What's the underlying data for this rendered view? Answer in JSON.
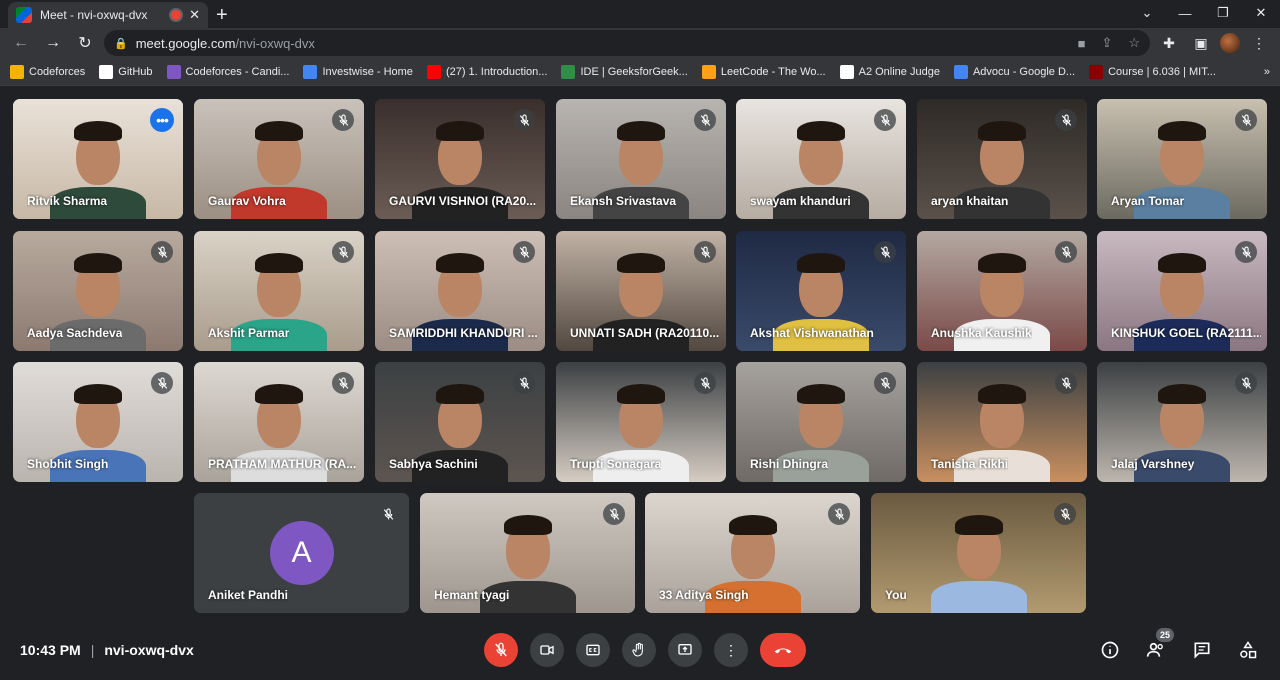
{
  "browser": {
    "tab_title": "Meet - nvi-oxwq-dvx",
    "url_host": "meet.google.com",
    "url_path": "/nvi-oxwq-dvx"
  },
  "bookmarks": [
    {
      "label": "Codeforces",
      "color": "#f4b400"
    },
    {
      "label": "GitHub",
      "color": "#ffffff"
    },
    {
      "label": "Codeforces - Candi...",
      "color": "#7e57c2"
    },
    {
      "label": "Investwise - Home",
      "color": "#4285f4"
    },
    {
      "label": "(27) 1. Introduction...",
      "color": "#ff0000"
    },
    {
      "label": "IDE | GeeksforGeek...",
      "color": "#2f8d46"
    },
    {
      "label": "LeetCode - The Wo...",
      "color": "#ffa116"
    },
    {
      "label": "A2 Online Judge",
      "color": "#ffffff"
    },
    {
      "label": "Advocu - Google D...",
      "color": "#4285f4"
    },
    {
      "label": "Course | 6.036 | MIT...",
      "color": "#8b0000"
    }
  ],
  "participants": [
    {
      "name": "Ritvik Sharma"
    },
    {
      "name": "Gaurav Vohra"
    },
    {
      "name": "GAURVI VISHNOI (RA20..."
    },
    {
      "name": "Ekansh Srivastava"
    },
    {
      "name": "swayam khanduri"
    },
    {
      "name": "aryan khaitan"
    },
    {
      "name": "Aryan Tomar"
    },
    {
      "name": "Aadya Sachdeva"
    },
    {
      "name": "Akshit Parmar"
    },
    {
      "name": "SAMRIDDHI KHANDURI ..."
    },
    {
      "name": "UNNATI SADH (RA20110..."
    },
    {
      "name": "Akshat Vishwanathan"
    },
    {
      "name": "Anushka Kaushik"
    },
    {
      "name": "KINSHUK GOEL (RA2111..."
    },
    {
      "name": "Shobhit Singh"
    },
    {
      "name": "PRATHAM MATHUR (RA..."
    },
    {
      "name": "Sabhya Sachini"
    },
    {
      "name": "Trupti Sonagara"
    },
    {
      "name": "Rishi Dhingra"
    },
    {
      "name": "Tanisha Rikhi"
    },
    {
      "name": "Jalaj Varshney"
    },
    {
      "name": "Aniket Pandhi",
      "initial": "A"
    },
    {
      "name": "Hemant tyagi"
    },
    {
      "name": "33 Aditya Singh"
    },
    {
      "name": "You"
    }
  ],
  "bottom": {
    "time": "10:43 PM",
    "meeting_code": "nvi-oxwq-dvx",
    "people_count": "25"
  }
}
